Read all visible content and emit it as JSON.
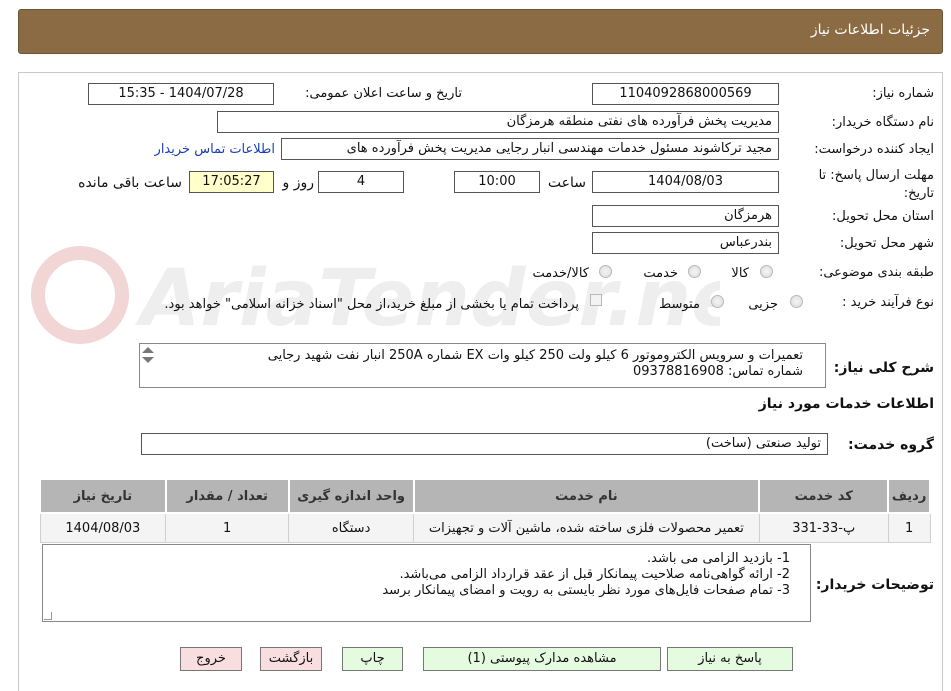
{
  "header": {
    "title": "جزئیات اطلاعات نیاز"
  },
  "fields": {
    "need_number_label": "شماره نیاز:",
    "need_number": "1104092868000569",
    "announce_label": "تاریخ و ساعت اعلان عمومی:",
    "announce_value": "1404/07/28 - 15:35",
    "buyer_org_label": "نام دستگاه خریدار:",
    "buyer_org": "مدیریت پخش فرآورده های نفتی منطقه هرمزگان",
    "creator_label": "ایجاد کننده درخواست:",
    "creator": "مجید ترکاشوند مسئول خدمات مهندسی انبار رجایی مدیریت پخش فرآورده های",
    "contact_link": "اطلاعات تماس خریدار",
    "deadline_label": "مهلت ارسال پاسخ: تا تاریخ:",
    "deadline_date": "1404/08/03",
    "time_label": "ساعت",
    "deadline_time": "10:00",
    "days_value": "4",
    "days_label": "روز و",
    "remaining_time": "17:05:27",
    "remaining_label": "ساعت باقی مانده",
    "province_label": "استان محل تحویل:",
    "province": "هرمزگان",
    "city_label": "شهر محل تحویل:",
    "city": "بندرعباس",
    "category_label": "طبقه بندی موضوعی:",
    "category_options": [
      "کالا",
      "خدمت",
      "کالا/خدمت"
    ],
    "process_label": "نوع فرآیند خرید :",
    "process_options": [
      "جزیی",
      "متوسط"
    ],
    "payment_note": "پرداخت تمام یا بخشی از مبلغ خرید،از محل \"اسناد خزانه اسلامی\" خواهد بود.",
    "summary_label": "شرح کلی نیاز:",
    "summary_line1": "تعمیرات و سرویس الکتروموتور 6 کیلو ولت 250 کیلو وات EX  شماره 250A  انبار نفت شهید رجایی",
    "summary_line2": "شماره تماس: 09378816908"
  },
  "services": {
    "section_title": "اطلاعات خدمات مورد نیاز",
    "group_label": "گروه خدمت:",
    "group_value": "تولید صنعتی (ساخت)",
    "columns": [
      "ردیف",
      "کد خدمت",
      "نام خدمت",
      "واحد اندازه گیری",
      "تعداد / مقدار",
      "تاریخ نیاز"
    ],
    "rows": [
      [
        "1",
        "پ-33-331",
        "تعمیر محصولات فلزی ساخته شده، ماشین آلات و تجهیزات",
        "دستگاه",
        "1",
        "1404/08/03"
      ]
    ]
  },
  "buyer_notes": {
    "label": "توضیحات خریدار:",
    "lines": [
      "1-    بازدید الزامی می باشد.",
      "2-    ارائه گواهی‌نامه صلاحیت پیمانکار قبل از عقد قرارداد الزامی می‌باشد.",
      "3-    تمام صفحات فایل‌های مورد نظر بایستی به رویت و امضای پیمانکار برسد"
    ]
  },
  "buttons": {
    "reply": "پاسخ به نیاز",
    "attachments": "مشاهده مدارک پیوستی (1)",
    "print": "چاپ",
    "back": "بازگشت",
    "exit": "خروج"
  },
  "watermark": {
    "text": "AriaTender.neT"
  },
  "colors": {
    "header": "#8b6b43",
    "link": "#1a3fb8",
    "yellow_box": "#ffffcc",
    "table_head": "#b5b5b5"
  }
}
